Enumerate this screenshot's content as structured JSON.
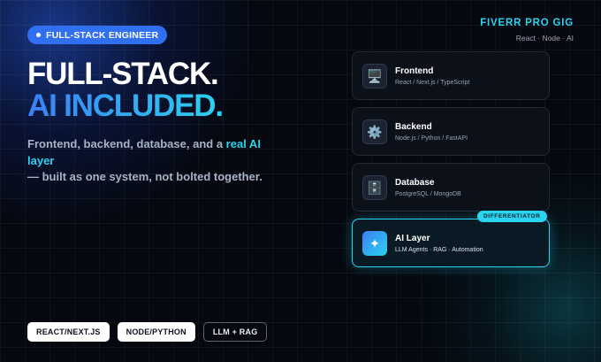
{
  "badge": {
    "label": "FULL-STACK ENGINEER"
  },
  "headline": {
    "line1": "FULL-STACK.",
    "line2": "AI INCLUDED."
  },
  "lead": {
    "part1": "Frontend, backend, database, and a ",
    "highlight": "real AI layer",
    "part2": "— built as one system, not bolted together."
  },
  "gig": {
    "title": "FIVERR PRO GIG",
    "subtitle": "React · Node · AI"
  },
  "cards": [
    {
      "title": "Frontend",
      "subtitle": "React / Next.js / TypeScript",
      "icon": "monitor-icon",
      "glyph": "🖥️"
    },
    {
      "title": "Backend",
      "subtitle": "Node.js / Python / FastAPI",
      "icon": "gear-icon",
      "glyph": "⚙️"
    },
    {
      "title": "Database",
      "subtitle": "PostgreSQL / MongoDB",
      "icon": "database-icon",
      "glyph": "🗄️"
    },
    {
      "title": "AI Layer",
      "subtitle": "LLM Agents · RAG · Automation",
      "icon": "sparkle-icon",
      "glyph": "✦",
      "tag": "DIFFERENTIATOR"
    }
  ],
  "pills": [
    "REACT/NEXT.JS",
    "NODE/PYTHON",
    "LLM + RAG"
  ],
  "colors": {
    "accent_blue": "#2f6ff0",
    "accent_cyan": "#2ad3f0",
    "background": "#05080f"
  }
}
